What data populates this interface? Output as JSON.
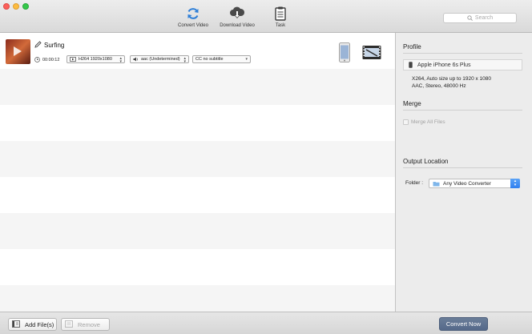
{
  "toolbar": {
    "convert_label": "Convert Video",
    "download_label": "Download Video",
    "task_label": "Task",
    "search_placeholder": "Search"
  },
  "file": {
    "title": "Surfing",
    "duration": "00:00:12",
    "video_track": "H264 1920x1080",
    "audio_track": "aac (Undetermined)",
    "subtitle": "CC no subtitle"
  },
  "panel": {
    "profile_heading": "Profile",
    "profile_device": "Apple iPhone 6s Plus",
    "profile_spec_1": "X264, Auto size up to 1920 x 1080",
    "profile_spec_2": "AAC, Stereo, 48000 Hz",
    "merge_heading": "Merge",
    "merge_label": "Merge All Files",
    "merge_checked": false,
    "output_heading": "Output Location",
    "folder_label": "Folder :",
    "folder_value": "Any Video Converter"
  },
  "bottom": {
    "add_label": "Add File(s)",
    "remove_label": "Remove",
    "convert_now_label": "Convert Now"
  },
  "colors": {
    "convert_icon": "#2f7fd8",
    "convert_button": "#5f7392",
    "folder_stepper": "#3b87f2"
  }
}
